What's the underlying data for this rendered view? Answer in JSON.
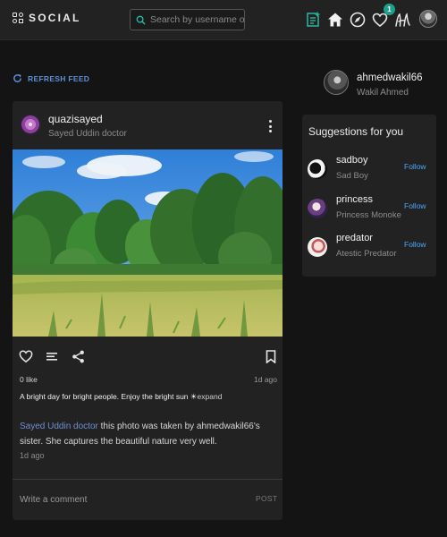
{
  "nav": {
    "brand": "SOCIAL",
    "search_placeholder": "Search by username or name",
    "icons": [
      "new-post-icon",
      "home-icon",
      "explore-compass-icon",
      "heart-icon",
      "signature-icon"
    ],
    "notification_count": "1"
  },
  "feed": {
    "refresh_label": "REFRESH FEED",
    "post": {
      "username": "quazisayed",
      "subtitle": "Sayed Uddin doctor",
      "likes": "0 like",
      "time": "1d ago",
      "caption": "A bright day for bright people. Enjoy the bright sun ☀",
      "expand_label": "expand",
      "comment": {
        "author": "Sayed Uddin doctor",
        "text": " this photo was taken by ahmedwakil66's sister. She captures the beautiful nature very well.",
        "time": "1d ago"
      },
      "comment_placeholder": "Write a comment",
      "post_button": "POST"
    }
  },
  "profile": {
    "username": "ahmedwakil66",
    "name": "Wakil Ahmed"
  },
  "suggestions": {
    "title": "Suggestions for you",
    "follow_label": "Follow",
    "items": [
      {
        "username": "sadboy",
        "name": "Sad Boy"
      },
      {
        "username": "princess",
        "name": "Princess Monoke"
      },
      {
        "username": "predator",
        "name": "Atestic Predator"
      }
    ]
  },
  "colors": {
    "accent": "#4aa8ff",
    "badge": "#1f9f8e",
    "new_post_icon": "#29b7a0",
    "link": "#6f8fd6"
  }
}
